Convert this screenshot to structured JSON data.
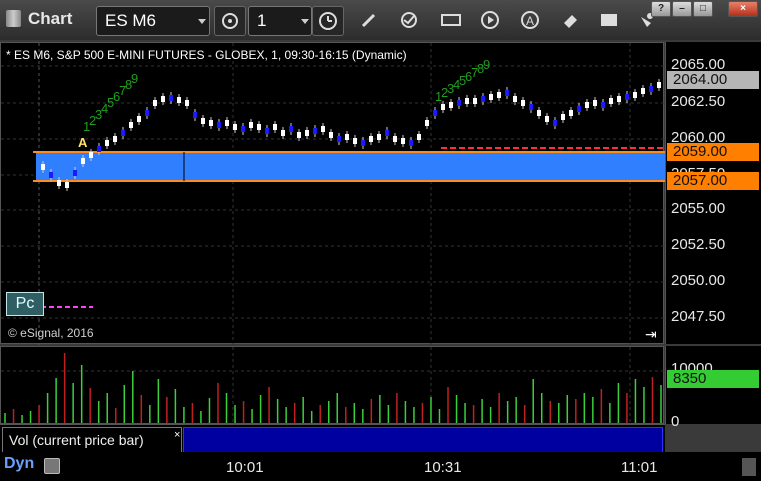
{
  "window": {
    "title": "Chart"
  },
  "toolbar": {
    "symbol": "ES M6",
    "interval": "1"
  },
  "chart": {
    "header": "* ES M6, S&P 500 E-MINI FUTURES - GLOBEX, 1, 09:30-16:15 (Dynamic)",
    "copyright": "© eSignal, 2016",
    "pc_label": "Pc",
    "marker_a": "A",
    "price_labels": [
      "2065.00",
      "2062.50",
      "2060.00",
      "2057.50",
      "2055.00",
      "2052.50",
      "2050.00",
      "2047.50"
    ],
    "last_price": "2064.00",
    "level_upper": "2059.00",
    "level_lower": "2057.00",
    "seq_left": [
      "1",
      "2",
      "3",
      "4",
      "5",
      "6",
      "7",
      "8",
      "9"
    ],
    "seq_right": [
      "1",
      "2",
      "3",
      "4",
      "5",
      "6",
      "7",
      "8",
      "9"
    ]
  },
  "volume": {
    "axis_top": "10000",
    "last_volume": "8350",
    "axis_bottom": "0",
    "study_label": "Vol (current price bar)",
    "close_glyph": "×"
  },
  "time_axis": {
    "labels": [
      "10:01",
      "10:31",
      "11:01"
    ]
  },
  "status": {
    "dyn": "Dyn"
  },
  "colors": {
    "up": "#ffffff",
    "down": "#1a1aff",
    "zone_fill": "#2f7fff",
    "level_line": "#ff8c1a",
    "last_price_tag": "#a8a8a8",
    "level_tag": "#ff7f00",
    "volume_tag": "#33cc33",
    "sequence": "#1f9f1f"
  },
  "icons": [
    "crosshair-icon",
    "pencil-icon",
    "refresh-icon",
    "edit-icon",
    "play-icon",
    "alert-icon",
    "eraser-icon",
    "quote-icon",
    "link-icon"
  ]
}
